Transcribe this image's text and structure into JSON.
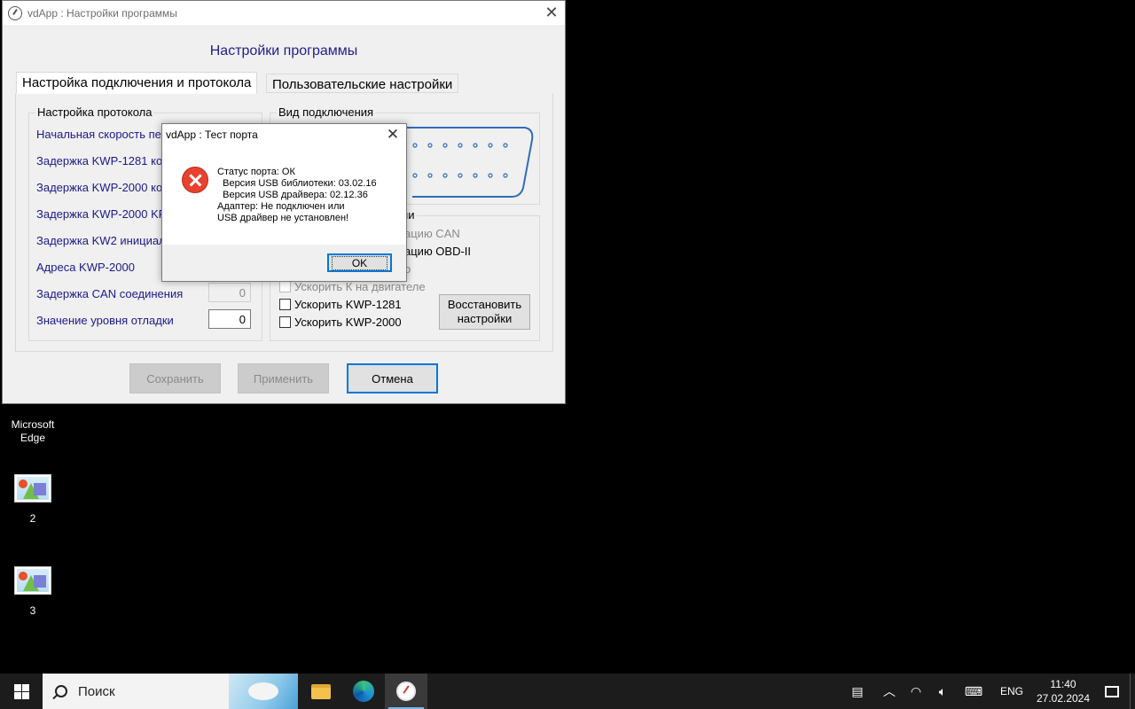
{
  "desktop": {
    "icons": [
      {
        "label": "Microsoft\nEdge"
      },
      {
        "label": "2"
      },
      {
        "label": "3"
      }
    ]
  },
  "window": {
    "title": "vdApp :  Настройки программы",
    "heading": "Настройки программы",
    "tabs": [
      {
        "label": "Настройка подключения и протокола"
      },
      {
        "label": "Пользовательские настройки"
      }
    ],
    "protocol_group": {
      "title": "Настройка протокола",
      "labels": [
        "Начальная скорость передачи",
        "Задержка KWP-1281 команд",
        "Задержка KWP-2000 команд",
        "Задержка KWP-2000 KP",
        "Задержка KW2 инициализации",
        "Адреса KWP-2000",
        "Задержка CAN соединения",
        "Значение уровня отладки"
      ],
      "can_delay_value": "0",
      "debug_level_value": "0"
    },
    "connection_group": {
      "title": "Вид подключения"
    },
    "options_group": {
      "title_fragment": "ии",
      "can_init_fragment": "ацию CAN",
      "obd_init_fragment": "ацию OBD-II",
      "hidden_fragment": "о",
      "speed_up_engine_k": "Ускорить К на двигателе",
      "speed_up_kwp1281": "Ускорить KWP-1281",
      "speed_up_kwp2000": "Ускорить KWP-2000",
      "restore_button": "Восстановить настройки"
    },
    "buttons": {
      "save": "Сохранить",
      "apply": "Применить",
      "cancel": "Отмена"
    }
  },
  "dialog": {
    "title": "vdApp :  Тест порта",
    "lines": [
      "Статус порта: ОК",
      "  Версия USB библиотеки: 03.02.16",
      "  Версия USB драйвера: 02.12.36",
      "Адаптер: Не подключен или",
      "USB драйвер не установлен!"
    ],
    "ok_label": "OK"
  },
  "taskbar": {
    "search_placeholder": "Поиск",
    "lang": "ENG",
    "time": "11:40",
    "date": "27.02.2024"
  }
}
